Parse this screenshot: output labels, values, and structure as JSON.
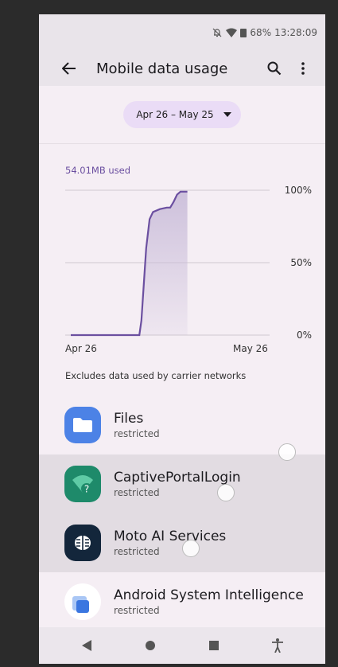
{
  "status": {
    "battery": "68%",
    "time": "13:28:09"
  },
  "header": {
    "title": "Mobile data usage"
  },
  "date_range": {
    "label": "Apr 26 – May 25"
  },
  "usage": {
    "used_label": "54.01MB used",
    "note": "Excludes data used by carrier networks"
  },
  "chart_data": {
    "type": "area",
    "x_labels": [
      "Apr 26",
      "May 26"
    ],
    "y_ticks": [
      "100%",
      "50%",
      "0%"
    ],
    "x": [
      0,
      5,
      10,
      10.3,
      11,
      11.5,
      12,
      13,
      14,
      14.5,
      15,
      15.5,
      16,
      17
    ],
    "y": [
      0,
      0,
      0,
      10,
      60,
      80,
      85,
      87,
      88,
      88,
      92,
      97,
      99,
      99
    ],
    "ylim": [
      0,
      100
    ],
    "color": "#6b4fa0"
  },
  "apps": [
    {
      "name": "Files",
      "status": "restricted",
      "icon": "files-icon"
    },
    {
      "name": "CaptivePortalLogin",
      "status": "restricted",
      "icon": "captive-portal-icon"
    },
    {
      "name": "Moto AI Services",
      "status": "restricted",
      "icon": "moto-ai-icon"
    },
    {
      "name": "Android System Intelligence",
      "status": "restricted",
      "icon": "asi-icon"
    }
  ]
}
